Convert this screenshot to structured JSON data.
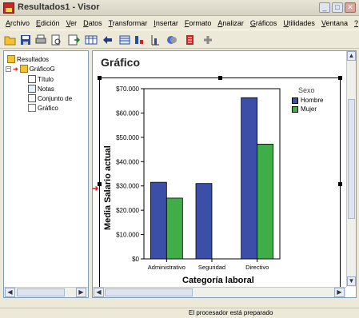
{
  "window": {
    "title": "Resultados1 - Visor"
  },
  "menu": {
    "items": [
      {
        "label": "Archivo"
      },
      {
        "label": "Edición"
      },
      {
        "label": "Ver"
      },
      {
        "label": "Datos"
      },
      {
        "label": "Transformar"
      },
      {
        "label": "Insertar"
      },
      {
        "label": "Formato"
      },
      {
        "label": "Analizar"
      },
      {
        "label": "Gráficos"
      },
      {
        "label": "Utilidades"
      },
      {
        "label": "Ventana"
      },
      {
        "label": "?"
      }
    ]
  },
  "toolbar": {
    "icons": [
      "open-icon",
      "save-icon",
      "print-icon",
      "print-preview-icon",
      "export-icon",
      "goto-data-icon",
      "back-icon",
      "variables-icon",
      "case-icon",
      "chart-builder-icon",
      "select-icon",
      "insert-icon",
      "add-icon"
    ]
  },
  "outline": {
    "nodes": [
      {
        "label": "Resultados",
        "icon": "output-book-icon"
      },
      {
        "label": "GráficoG",
        "icon": "chart-book-icon"
      },
      {
        "label": "Título",
        "icon": "title-icon"
      },
      {
        "label": "Notas",
        "icon": "notes-icon"
      },
      {
        "label": "Conjunto de",
        "icon": "dataset-icon"
      },
      {
        "label": "Gráfico",
        "icon": "chart-icon"
      }
    ]
  },
  "content": {
    "heading": "Gráfico"
  },
  "chart_data": {
    "type": "bar",
    "title": "",
    "xlabel": "Categoría laboral",
    "ylabel": "Media Salario actual",
    "categories": [
      "Administrativo",
      "Seguridad",
      "Directivo"
    ],
    "series": [
      {
        "name": "Hombre",
        "values": [
          31500,
          31000,
          66300
        ],
        "color": "#3b4fa8"
      },
      {
        "name": "Mujer",
        "values": [
          25000,
          null,
          47200
        ],
        "color": "#3fae49"
      }
    ],
    "ylim": [
      0,
      70000
    ],
    "yticks": [
      "$0",
      "$10.000",
      "$20.000",
      "$30.000",
      "$40.000",
      "$50.000",
      "$60.000",
      "$70.000"
    ],
    "legend_title": "Sexo",
    "legend_position": "top-right",
    "grid": false
  },
  "status": {
    "text": "El procesador está preparado"
  }
}
